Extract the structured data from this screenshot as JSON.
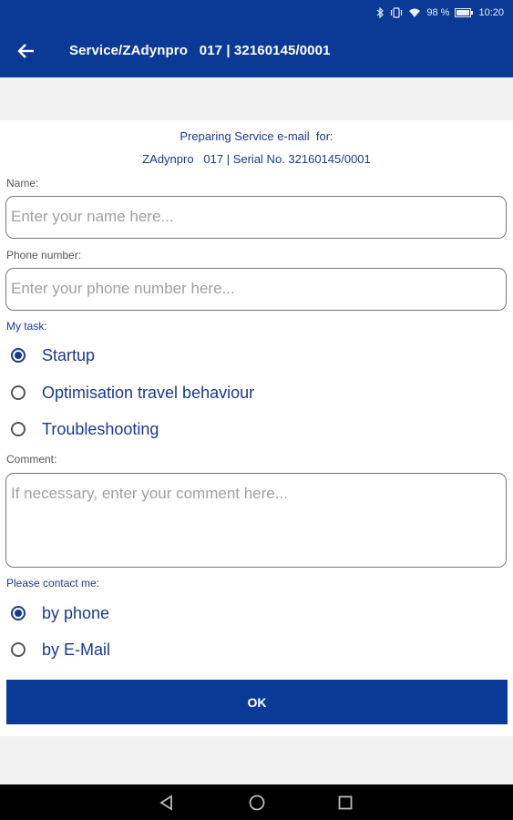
{
  "status_bar": {
    "battery": "98 %",
    "time": "10:20"
  },
  "app_bar": {
    "title": "Service/ZAdynpro   017 | 32160145/0001"
  },
  "intro": {
    "line1": "Preparing Service e-mail  for:",
    "line2": "ZAdynpro   017 | Serial No. 32160145/0001"
  },
  "name": {
    "label": "Name:",
    "placeholder": "Enter your name here...",
    "value": ""
  },
  "phone": {
    "label": "Phone number:",
    "placeholder": "Enter your phone number here...",
    "value": ""
  },
  "task": {
    "label": "My task:",
    "options": [
      {
        "label": "Startup",
        "checked": true
      },
      {
        "label": "Optimisation travel behaviour",
        "checked": false
      },
      {
        "label": "Troubleshooting",
        "checked": false
      }
    ]
  },
  "comment": {
    "label": "Comment:",
    "placeholder": "If necessary, enter your comment here...",
    "value": ""
  },
  "contact": {
    "label": "Please contact me:",
    "options": [
      {
        "label": "by phone",
        "checked": true
      },
      {
        "label": "by E-Mail",
        "checked": false
      }
    ]
  },
  "ok_label": "OK",
  "icons": {
    "back": "arrow-left-icon",
    "bluetooth": "bluetooth-icon",
    "vibrate": "vibrate-icon",
    "wifi": "wifi-icon",
    "battery": "battery-icon",
    "nav_back": "triangle-back-icon",
    "nav_home": "circle-home-icon",
    "nav_recent": "square-recent-icon"
  },
  "colors": {
    "primary": "#0a3a96",
    "text_blue": "#1b3a8c"
  }
}
